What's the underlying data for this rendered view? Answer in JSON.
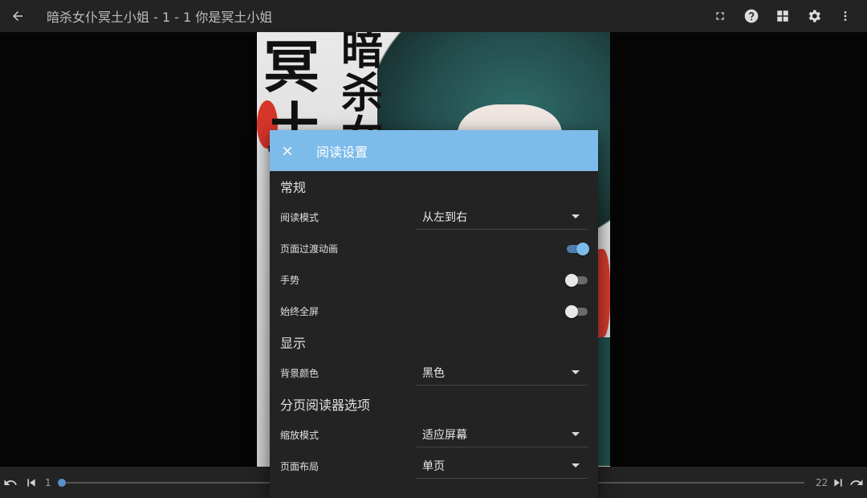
{
  "topbar": {
    "title": "暗杀女仆冥土小姐 - 1 - 1 你是冥土小姐",
    "icons": [
      "back-arrow-icon",
      "fullscreen-icon",
      "help-icon",
      "grid-view-icon",
      "settings-gear-icon",
      "more-vert-icon"
    ]
  },
  "page_image": {
    "kanji": [
      "冥",
      "土",
      "暗",
      "杀",
      "女"
    ]
  },
  "dialog": {
    "title": "阅读设置",
    "sections": {
      "general": "常规",
      "display": "显示",
      "paged": "分页阅读器选项"
    },
    "rows": {
      "reading_mode": {
        "label": "阅读模式",
        "value": "从左到右"
      },
      "page_transition": {
        "label": "页面过渡动画",
        "on": true
      },
      "gestures": {
        "label": "手势",
        "on": false
      },
      "always_fullscreen": {
        "label": "始终全屏",
        "on": false
      },
      "background_color": {
        "label": "背景颜色",
        "value": "黑色"
      },
      "zoom_mode": {
        "label": "缩放模式",
        "value": "适应屏幕"
      },
      "page_layout": {
        "label": "页面布局",
        "value": "单页"
      }
    }
  },
  "bottombar": {
    "current_page": "1",
    "total_pages": "22",
    "progress_fraction": 0.0
  },
  "colors": {
    "accent": "#7dbbea",
    "bar": "#232323",
    "dialog_bg": "#232323"
  }
}
